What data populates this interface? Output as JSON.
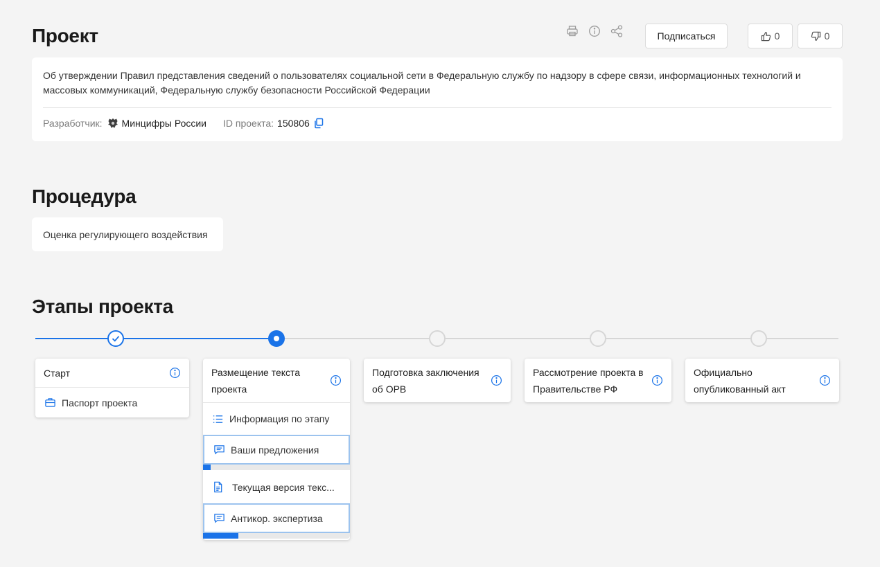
{
  "project": {
    "title": "Проект",
    "subscribe_label": "Подписаться",
    "likes": "0",
    "dislikes": "0",
    "description": "Об утверждении Правил представления сведений о пользователях социальной сети в Федеральную службу по надзору в сфере связи, информационных технологий и массовых коммуникаций, Федеральную службу безопасности Российской Федерации",
    "developer_label": "Разработчик:",
    "developer_value": "Минцифры России",
    "id_label": "ID проекта:",
    "id_value": "150806"
  },
  "procedure": {
    "title": "Процедура",
    "value": "Оценка регулирующего воздействия"
  },
  "stages": {
    "title": "Этапы проекта",
    "items": [
      {
        "title": "Старт",
        "rows": [
          "Паспорт проекта"
        ]
      },
      {
        "title": "Размещение текста проекта",
        "rows": [
          "Информация по этапу",
          "Ваши предложения",
          "Текущая версия текс...",
          "Антикор. экспертиза"
        ],
        "progress": [
          0.05,
          0.24
        ]
      },
      {
        "title": "Подготовка заключения об ОРВ",
        "rows": []
      },
      {
        "title": "Рассмотрение проекта в Правительстве РФ",
        "rows": []
      },
      {
        "title": "Официально опубликованный акт",
        "rows": []
      }
    ]
  },
  "colors": {
    "accent": "#1a73e8",
    "inactive": "#d6d6d6"
  },
  "icons": [
    "print-icon",
    "info-icon",
    "share-icon",
    "thumb-up-icon",
    "thumb-down-icon",
    "emblem-icon",
    "copy-icon",
    "check-icon",
    "briefcase-icon",
    "list-icon",
    "comment-icon",
    "document-icon"
  ]
}
